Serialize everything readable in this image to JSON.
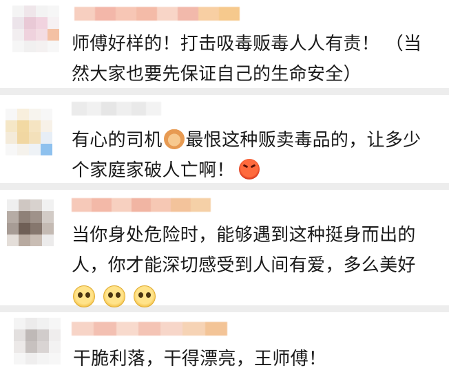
{
  "comments": [
    {
      "text_1": "师傅好样的！打击吸毒贩毒人人有责！ （当然大家也要先保证自己的生命安全）"
    },
    {
      "text_1": "有心的司机",
      "emoji_1": "praying-hands-emoji",
      "text_2": "最恨这种贩卖毒品的，让多少个家庭家破人亡啊！",
      "emoji_2": "angry-face-emoji"
    },
    {
      "text_1": "当你身处危险时，能够遇到这种挺身而出的人，你才能深切感受到人间有爱，多么美好",
      "emoji_1": "pleading-face-emoji",
      "emoji_count": 3
    },
    {
      "text_1": "干脆利落，干得漂亮，王师傅！"
    }
  ],
  "colors": {
    "background": "#ededed",
    "card": "#ffffff",
    "text": "#1a1a1a"
  }
}
